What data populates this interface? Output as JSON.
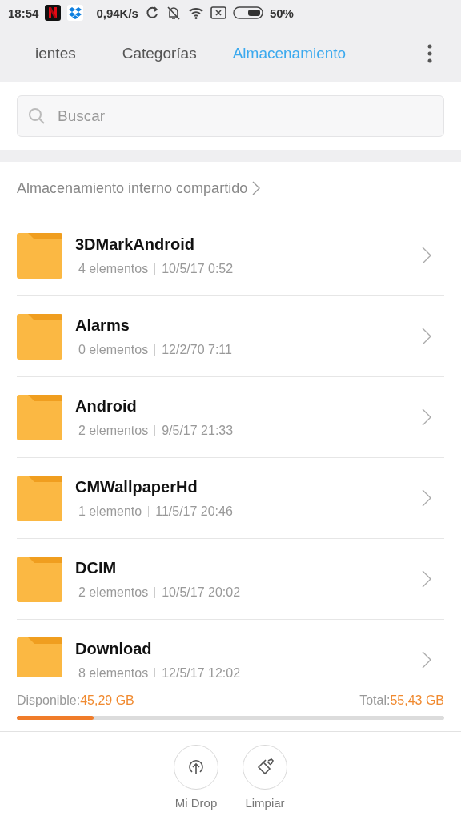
{
  "status_bar": {
    "time": "18:54",
    "speed": "0,94K/s",
    "battery": "50%"
  },
  "tabs": [
    {
      "label": "ientes",
      "selected": false
    },
    {
      "label": "Categorías",
      "selected": false
    },
    {
      "label": "Almacenamiento",
      "selected": true
    }
  ],
  "search": {
    "placeholder": "Buscar"
  },
  "breadcrumb": "Almacenamiento interno compartido",
  "folders": [
    {
      "name": "3DMarkAndroid",
      "count": "4 elementos",
      "date": "10/5/17 0:52"
    },
    {
      "name": "Alarms",
      "count": "0 elementos",
      "date": "12/2/70 7:11"
    },
    {
      "name": "Android",
      "count": "2 elementos",
      "date": "9/5/17 21:33"
    },
    {
      "name": "CMWallpaperHd",
      "count": "1 elemento",
      "date": "11/5/17 20:46"
    },
    {
      "name": "DCIM",
      "count": "2 elementos",
      "date": "10/5/17 20:02"
    },
    {
      "name": "Download",
      "count": "8 elementos",
      "date": "12/5/17 12:02"
    }
  ],
  "storage": {
    "available_label": "Disponible:",
    "available": "45,29 GB",
    "total_label": "Total:",
    "total": "55,43 GB",
    "level": 0.18
  },
  "actions": [
    {
      "kind": "upload",
      "label": "Mi Drop"
    },
    {
      "kind": "clean",
      "label": "Limpiar"
    }
  ]
}
